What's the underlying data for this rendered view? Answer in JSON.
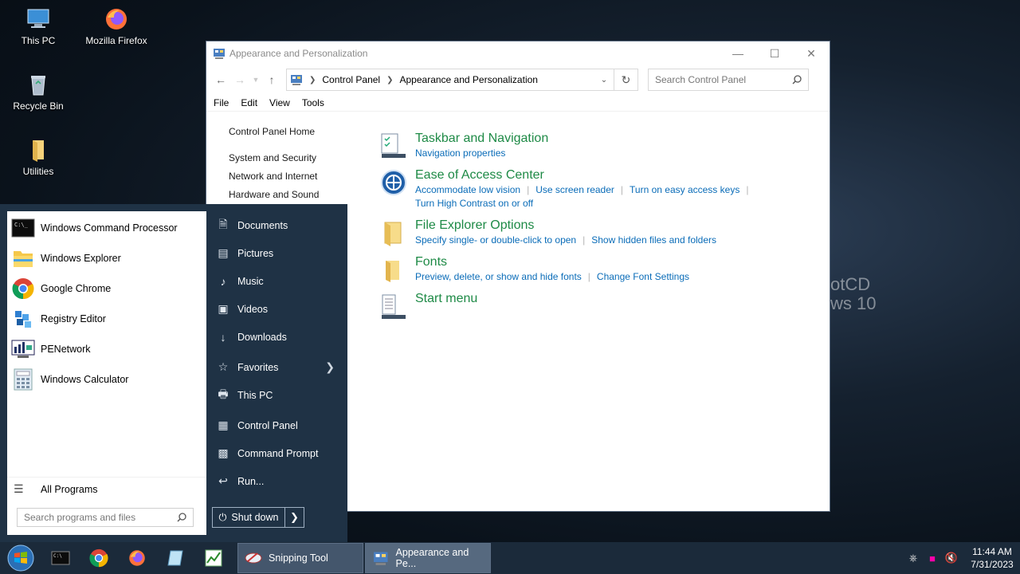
{
  "desktop": {
    "icons": [
      {
        "label": "This PC"
      },
      {
        "label": "Mozilla Firefox"
      },
      {
        "label": "Recycle Bin"
      },
      {
        "label": "Utilities"
      }
    ],
    "wallpaper_text": [
      "otCD",
      "ws 10"
    ]
  },
  "window": {
    "title": "Appearance and Personalization",
    "controls": {
      "minimize": "—",
      "maximize": "☐",
      "close": "✕"
    },
    "address": {
      "crumbs": [
        "Control Panel",
        "Appearance and Personalization"
      ]
    },
    "search": {
      "placeholder": "Search Control Panel"
    },
    "menu": [
      "File",
      "Edit",
      "View",
      "Tools"
    ],
    "sidebar": {
      "home": "Control Panel Home",
      "items": [
        "System and Security",
        "Network and Internet",
        "Hardware and Sound"
      ]
    },
    "categories": [
      {
        "title": "Taskbar and Navigation",
        "links": [
          "Navigation properties"
        ]
      },
      {
        "title": "Ease of Access Center",
        "links": [
          "Accommodate low vision",
          "Use screen reader",
          "Turn on easy access keys",
          "Turn High Contrast on or off"
        ]
      },
      {
        "title": "File Explorer Options",
        "links": [
          "Specify single- or double-click to open",
          "Show hidden files and folders"
        ]
      },
      {
        "title": "Fonts",
        "links": [
          "Preview, delete, or show and hide fonts",
          "Change Font Settings"
        ]
      },
      {
        "title": "Start menu",
        "links": []
      }
    ]
  },
  "startmenu": {
    "programs": [
      "Windows Command Processor",
      "Windows Explorer",
      "Google Chrome",
      "Registry Editor",
      "PENetwork",
      "Windows Calculator"
    ],
    "all_programs": "All Programs",
    "search": {
      "placeholder": "Search programs and files"
    },
    "right": [
      "Documents",
      "Pictures",
      "Music",
      "Videos",
      "Downloads",
      "Favorites",
      "This PC",
      "Control Panel",
      "Command Prompt",
      "Run..."
    ],
    "shutdown": "Shut down"
  },
  "taskbar": {
    "tasks": [
      "Snipping Tool",
      "Appearance and Pe..."
    ],
    "clock": {
      "time": "11:44 AM",
      "date": "7/31/2023"
    }
  },
  "colors": {
    "accent_green": "#1e8a46",
    "link_blue": "#0a6cb8",
    "startmenu_bg": "#1f3245",
    "taskbar_bg": "#1b2a3a"
  }
}
